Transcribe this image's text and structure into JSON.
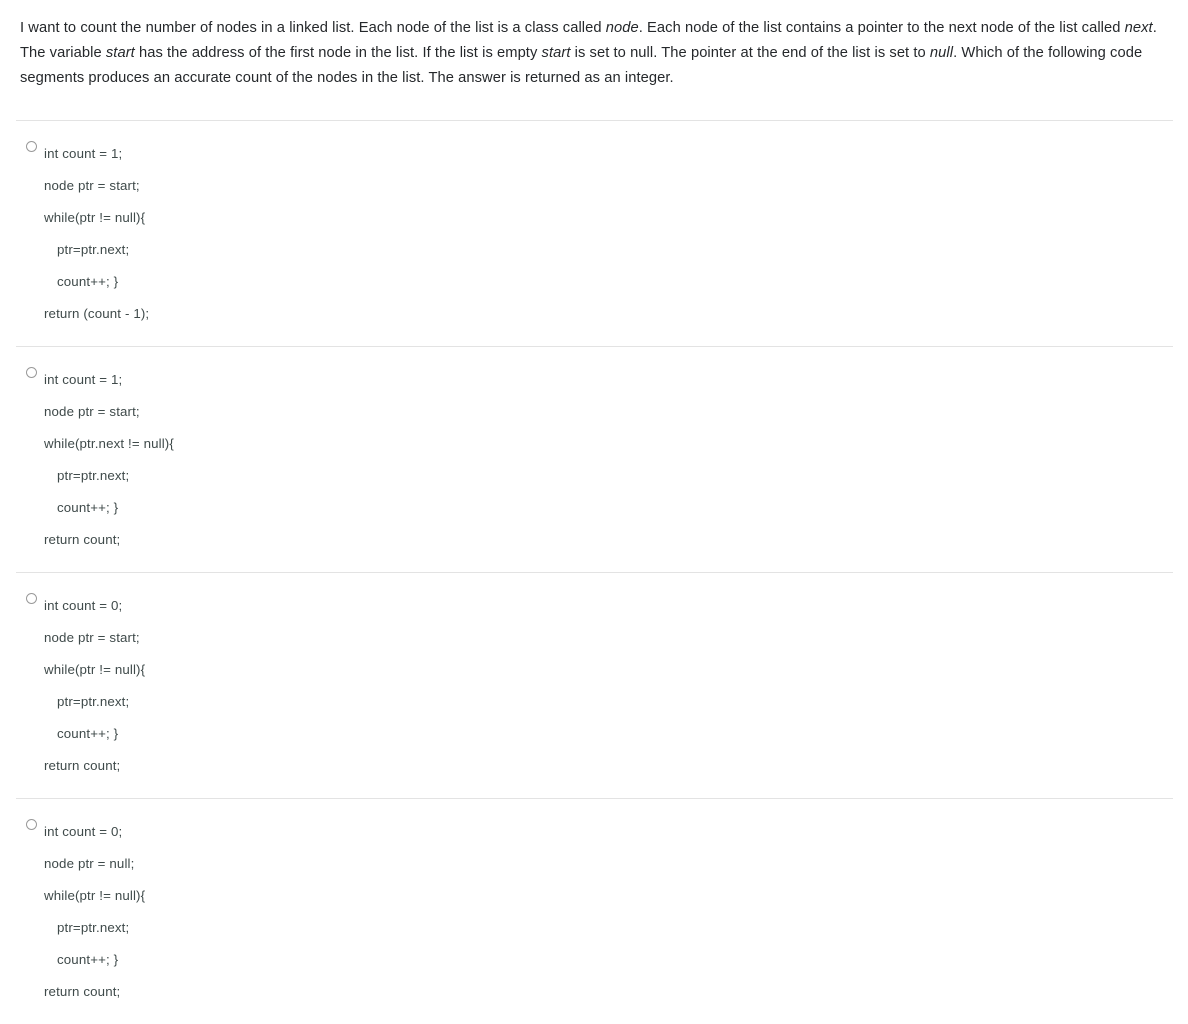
{
  "question": {
    "segments": [
      {
        "text": "I want to count the number of nodes in a linked list. Each node of the list is a class called ",
        "italic": false
      },
      {
        "text": "node",
        "italic": true
      },
      {
        "text": ". Each node of the list contains a pointer to the next node of the list called ",
        "italic": false
      },
      {
        "text": "next",
        "italic": true
      },
      {
        "text": ". The variable ",
        "italic": false
      },
      {
        "text": "start",
        "italic": true
      },
      {
        "text": " has the address of the first node in the list. If the list is empty ",
        "italic": false
      },
      {
        "text": "start",
        "italic": true
      },
      {
        "text": " is set to null. The pointer at the end of the list is set to ",
        "italic": false
      },
      {
        "text": "null",
        "italic": true
      },
      {
        "text": ". Which of the following code segments produces an accurate count of the nodes in the list. The answer is returned as an integer.",
        "italic": false
      }
    ]
  },
  "options": [
    {
      "id": "option-a",
      "selected": false,
      "lines": [
        {
          "text": "int count = 1;",
          "indent": 0
        },
        {
          "text": "node ptr = start;",
          "indent": 1
        },
        {
          "text": "while(ptr != null){",
          "indent": 1
        },
        {
          "text": "ptr=ptr.next;",
          "indent": 2
        },
        {
          "text": "count++; }",
          "indent": 2
        },
        {
          "text": "return (count - 1);",
          "indent": 1
        }
      ]
    },
    {
      "id": "option-b",
      "selected": false,
      "lines": [
        {
          "text": "int count = 1;",
          "indent": 0
        },
        {
          "text": "node ptr = start;",
          "indent": 1
        },
        {
          "text": "while(ptr.next != null){",
          "indent": 1
        },
        {
          "text": "ptr=ptr.next;",
          "indent": 2
        },
        {
          "text": "count++; }",
          "indent": 2
        },
        {
          "text": "return count;",
          "indent": 1
        }
      ]
    },
    {
      "id": "option-c",
      "selected": false,
      "lines": [
        {
          "text": "int count = 0;",
          "indent": 0
        },
        {
          "text": "node ptr = start;",
          "indent": 1
        },
        {
          "text": "while(ptr != null){",
          "indent": 1
        },
        {
          "text": "ptr=ptr.next;",
          "indent": 2
        },
        {
          "text": "count++; }",
          "indent": 2
        },
        {
          "text": "return count;",
          "indent": 1
        }
      ]
    },
    {
      "id": "option-d",
      "selected": false,
      "lines": [
        {
          "text": "int count = 0;",
          "indent": 0
        },
        {
          "text": "node ptr = null;",
          "indent": 1
        },
        {
          "text": "while(ptr != null){",
          "indent": 1
        },
        {
          "text": "ptr=ptr.next;",
          "indent": 2
        },
        {
          "text": "count++; }",
          "indent": 2
        },
        {
          "text": "return count;",
          "indent": 1
        }
      ]
    }
  ],
  "colors": {
    "page_background": "#ffffff",
    "question_text": "#25282b",
    "code_text": "#3f4a4a",
    "divider": "#e3e3e3",
    "radio_border": "#9a9a9a"
  }
}
